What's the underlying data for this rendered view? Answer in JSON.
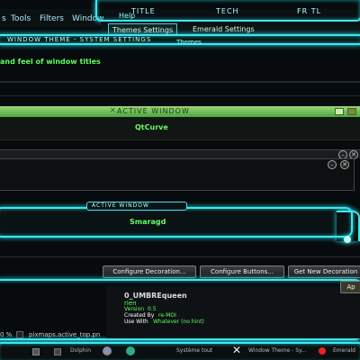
{
  "colors": {
    "accent_cyan": "#3ee6f0",
    "green_title": "#58c850",
    "text_green": "#5dff5d"
  },
  "menu": {
    "items": [
      "s",
      "Tools",
      "Filters",
      "Window"
    ],
    "help": "Help"
  },
  "top_tabs": [
    "TITLE",
    "TECH",
    "FR TL"
  ],
  "settings_tabs": {
    "themes": "Themes Settings",
    "emerald": "Emerald Settings"
  },
  "themes_label": "Themes",
  "window_theme_bar": "WINDOW THEME - SYSTEM SETTINGS",
  "window_titles_text": "and feel of window titles",
  "qtcurve_preview": {
    "title_icon": "✕",
    "title": "ACTIVE WINDOW",
    "label": "QtCurve"
  },
  "smaragd_preview": {
    "title": "ACTIVE WINDOW",
    "label": "Smaragd"
  },
  "inactive_controls": [
    "–",
    "✕"
  ],
  "lower_controls": [
    "–",
    "✕"
  ],
  "buttons": {
    "configure_decoration": "Configure Decoration...",
    "configure_buttons": "Configure Buttons...",
    "get_new": "Get New Decoration"
  },
  "theme_info": {
    "name": "0_UMBREqueen",
    "desc": "rien",
    "version_label": "Version",
    "version": "0.5",
    "created_label": "Created By",
    "created": "re-MOI",
    "use_label": "Use With",
    "use": "Whatever (no hint)"
  },
  "apply_label": "Ap",
  "status": {
    "zoom": "0 %",
    "file": "pixmaps.active_top.pn"
  },
  "taskbar": {
    "items": [
      "Dolphin",
      "Système tout",
      "Window Theme - Sy...",
      "Emerald"
    ]
  }
}
